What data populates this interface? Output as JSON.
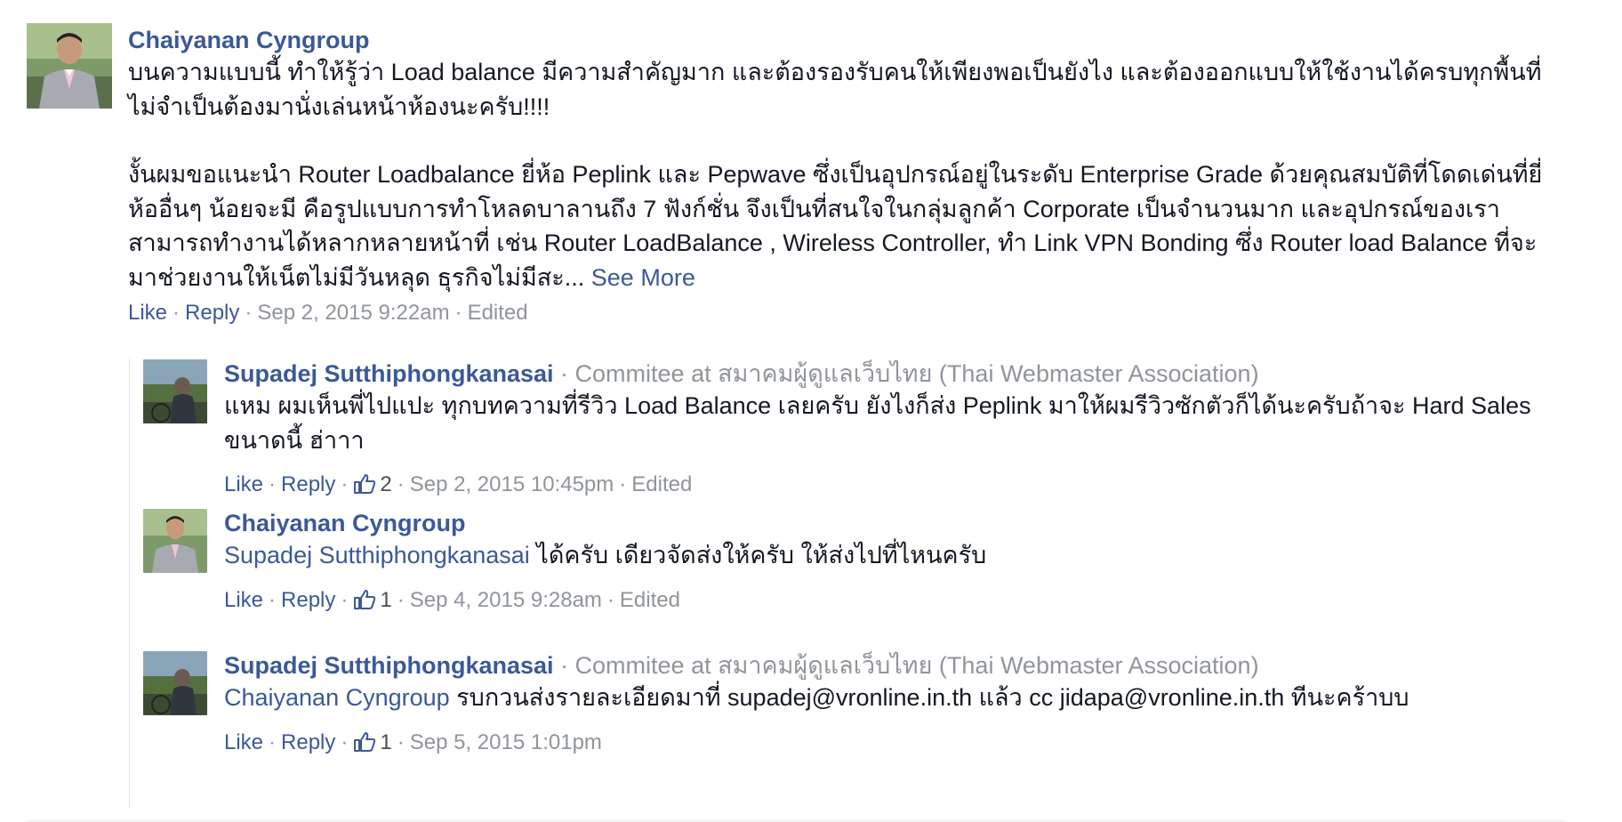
{
  "comment": {
    "author": "Chaiyanan Cyngroup",
    "paragraph1": "บนความแบบนี้ ทำให้รู้ว่า Load balance มีความสำคัญมาก และต้องรองรับคนให้เพียงพอเป็นยังไง และต้องออกแบบให้ใช้งานได้ครบทุกพื้นที่ ไม่จำเป็นต้องมานั่งเล่นหน้าห้องนะครับ!!!!",
    "paragraph2": "งั้นผมขอแนะนำ Router Loadbalance ยี่ห้อ Peplink และ Pepwave ซึ่งเป็นอุปกรณ์อยู่ในระดับ Enterprise Grade ด้วยคุณสมบัติที่โดดเด่นที่ยี่ห้ออื่นๆ น้อยจะมี คือรูปแบบการทำโหลดบาลานถึง 7 ฟังก์ชั่น จึงเป็นที่สนใจในกลุ่มลูกค้า Corporate เป็นจำนวนมาก และอุปกรณ์ของเราสามารถทำงานได้หลากหลายหน้าที่ เช่น Router LoadBalance , Wireless Controller, ทำ Link VPN Bonding ซึ่ง Router load Balance ที่จะมาช่วยงานให้เน็ตไม่มีวันหลุด ธุรกิจไม่มีสะ...",
    "see_more": "See More",
    "like_label": "Like",
    "reply_label": "Reply",
    "timestamp": "Sep 2, 2015 9:22am",
    "edited": "Edited"
  },
  "replies": [
    {
      "author": "Supadej Sutthiphongkanasai",
      "subtitle": "Commitee at สมาคมผู้ดูแลเว็บไทย (Thai Webmaster Association)",
      "mention": "",
      "text": "แหม ผมเห็นพี่ไปแปะ ทุกบทความที่รีวิว Load Balance เลยครับ ยังไงก็ส่ง Peplink มาให้ผมรีวิวซักตัวก็ได้นะครับถ้าจะ Hard Sales ขนาดนี้ ฮ่าาา",
      "like_label": "Like",
      "reply_label": "Reply",
      "likes": "2",
      "timestamp": "Sep 2, 2015 10:45pm",
      "edited": "Edited"
    },
    {
      "author": "Chaiyanan Cyngroup",
      "subtitle": "",
      "mention": "Supadej Sutthiphongkanasai",
      "text": " ได้ครับ เดียวจัดส่งให้ครับ ให้ส่งไปที่ไหนครับ",
      "like_label": "Like",
      "reply_label": "Reply",
      "likes": "1",
      "timestamp": "Sep 4, 2015 9:28am",
      "edited": "Edited"
    },
    {
      "author": "Supadej Sutthiphongkanasai",
      "subtitle": "Commitee at สมาคมผู้ดูแลเว็บไทย (Thai Webmaster Association)",
      "mention": "Chaiyanan Cyngroup",
      "text": " รบกวนส่งรายละเอียดมาที่ supadej@vronline.in.th แล้ว cc jidapa@vronline.in.th ทีนะคร้าบบ",
      "like_label": "Like",
      "reply_label": "Reply",
      "likes": "1",
      "timestamp": "Sep 5, 2015 1:01pm",
      "edited": ""
    }
  ],
  "colors": {
    "link": "#3b5998",
    "meta": "#90949c",
    "text": "#141823"
  }
}
